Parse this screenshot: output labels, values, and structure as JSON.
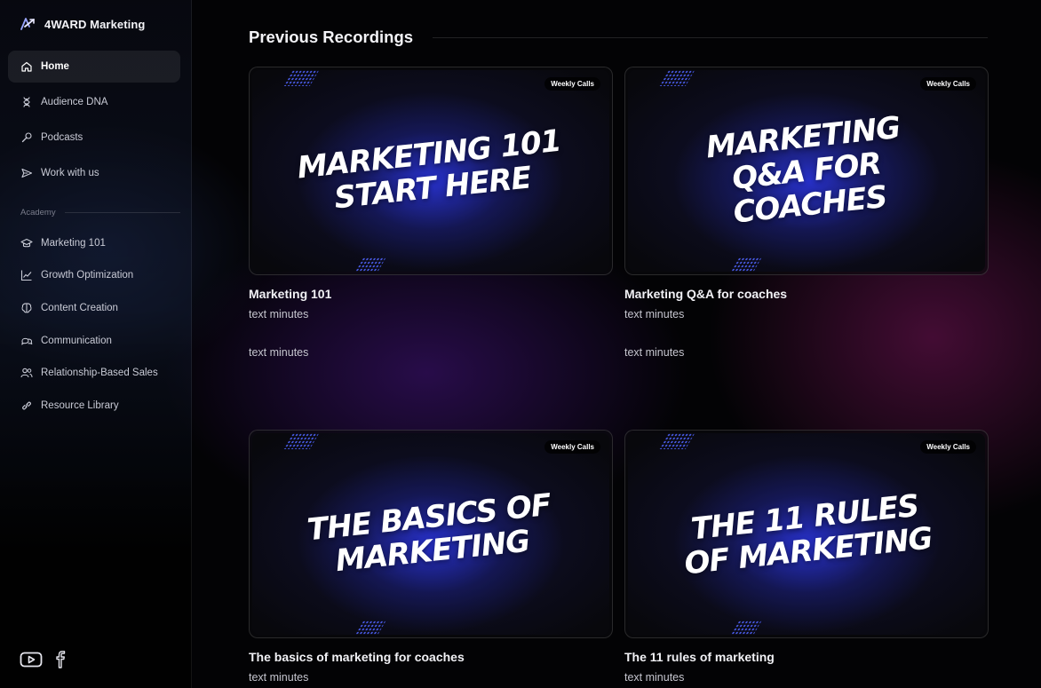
{
  "brand": {
    "name": "4WARD Marketing"
  },
  "nav": [
    {
      "label": "Home",
      "icon": "home-icon",
      "active": true
    },
    {
      "label": "Audience DNA",
      "icon": "dna-icon"
    },
    {
      "label": "Podcasts",
      "icon": "microphone-icon"
    },
    {
      "label": "Work with us",
      "icon": "send-icon"
    }
  ],
  "academy": {
    "label": "Academy",
    "items": [
      {
        "label": "Marketing 101",
        "icon": "graduation-cap-icon"
      },
      {
        "label": "Growth Optimization",
        "icon": "trend-chart-icon"
      },
      {
        "label": "Content Creation",
        "icon": "brain-icon"
      },
      {
        "label": "Communication",
        "icon": "chat-bubbles-icon"
      },
      {
        "label": "Relationship-Based Sales",
        "icon": "users-icon"
      },
      {
        "label": "Resource Library",
        "icon": "link-icon"
      }
    ]
  },
  "socials": [
    "youtube-icon",
    "facebook-icon"
  ],
  "main": {
    "heading": "Previous Recordings",
    "cards": [
      {
        "thumb_title": "Marketing 101 Start Here",
        "badge": "Weekly Calls",
        "title": "Marketing 101",
        "meta1": "text minutes",
        "meta2": "text minutes"
      },
      {
        "thumb_title": "Marketing Q&A for Coaches",
        "badge": "Weekly Calls",
        "title": "Marketing Q&A for coaches",
        "meta1": "text minutes",
        "meta2": "text minutes"
      },
      {
        "thumb_title": "The Basics of Marketing",
        "badge": "Weekly Calls",
        "title": "The basics of marketing for coaches",
        "meta1": "text minutes"
      },
      {
        "thumb_title": "The 11 Rules of Marketing",
        "badge": "Weekly Calls",
        "title": "The 11 rules of marketing",
        "meta1": "text minutes"
      }
    ]
  },
  "colors": {
    "accent_blue": "#2f3be0",
    "background": "#030305"
  }
}
